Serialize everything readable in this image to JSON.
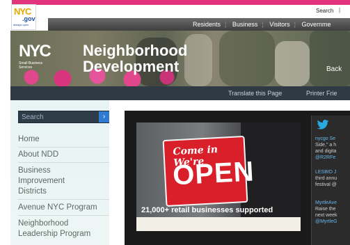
{
  "logo": {
    "nyc": "NYC",
    "gov": ".gov",
    "tag": "always open"
  },
  "top": {
    "search": "Search",
    "separator": "|"
  },
  "nav": {
    "items": [
      "Residents",
      "Business",
      "Visitors",
      "Governme"
    ]
  },
  "banner": {
    "agency": "NYC",
    "agency_sub": [
      "Small Business",
      "Services"
    ],
    "title_line1": "Neighborhood",
    "title_line2": "Development",
    "back": "Back"
  },
  "utility": {
    "translate": "Translate this Page",
    "printer": "Printer Frie"
  },
  "sidebar": {
    "search_placeholder": "Search",
    "go": "›",
    "items": [
      "Home",
      "About NDD",
      "Business",
      "Improvement",
      "Districts",
      "Avenue NYC Program",
      "Neighborhood",
      "Leadership Program"
    ]
  },
  "slide": {
    "sign_top": "Come in We're",
    "sign_main": "OPEN",
    "caption": "21,000+ retail businesses supported"
  },
  "tweets": {
    "t1": [
      "nycgo Se",
      "Side,\" a h",
      "and digita",
      "@R2RFe"
    ],
    "t2": [
      "LESBID J",
      "third annu",
      "festival @"
    ],
    "t3": [
      "MyrtleAve",
      "Raise the",
      "next week",
      "@MyrtleG"
    ]
  },
  "colors": {
    "accent_pink": "#e2337d",
    "nav_bg": "#4a4a4a",
    "twitter_blue": "#1da1f2"
  }
}
